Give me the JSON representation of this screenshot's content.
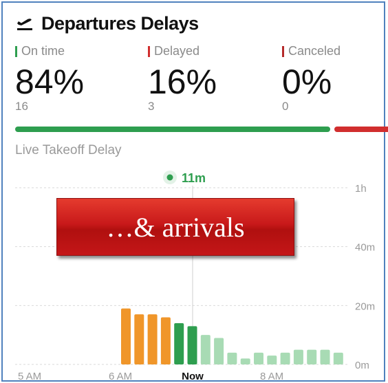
{
  "header": {
    "title": "Departures Delays",
    "icon": "plane-departure-icon"
  },
  "stats": [
    {
      "label": "On time",
      "percent": "84%",
      "count": "16",
      "color": "#2e9e4f"
    },
    {
      "label": "Delayed",
      "percent": "16%",
      "count": "3",
      "color": "#d12e2e"
    },
    {
      "label": "Canceled",
      "percent": "0%",
      "count": "0",
      "color": "#b52a2a"
    }
  ],
  "progress": {
    "on_time_fraction": 0.84,
    "delayed_fraction": 0.16,
    "on_time_color": "#2e9e4f",
    "delayed_color": "#d12e2e"
  },
  "section_title": "Live Takeoff Delay",
  "current_marker": {
    "label": "11m",
    "color": "#2e9e4f"
  },
  "banner": {
    "text": "…& arrivals"
  },
  "chart_data": {
    "type": "bar",
    "y_tick_labels": [
      "0m",
      "20m",
      "40m",
      "1h"
    ],
    "y_ticks": [
      0,
      20,
      40,
      60
    ],
    "ylim": [
      0,
      60
    ],
    "x_tick_labels": [
      "5 AM",
      "6 AM",
      "Now",
      "8 AM"
    ],
    "values": [
      19,
      17,
      17,
      16,
      14,
      13,
      10,
      9,
      4,
      2,
      4,
      3,
      4,
      5,
      5,
      5,
      4
    ],
    "colors": [
      "#f0962a",
      "#f0962a",
      "#f0962a",
      "#f0962a",
      "#2e9e4f",
      "#2e9e4f",
      "#a8dbb4",
      "#a8dbb4",
      "#a8dbb4",
      "#a8dbb4",
      "#a8dbb4",
      "#a8dbb4",
      "#a8dbb4",
      "#a8dbb4",
      "#a8dbb4",
      "#a8dbb4",
      "#a8dbb4"
    ],
    "current_value": 11
  }
}
